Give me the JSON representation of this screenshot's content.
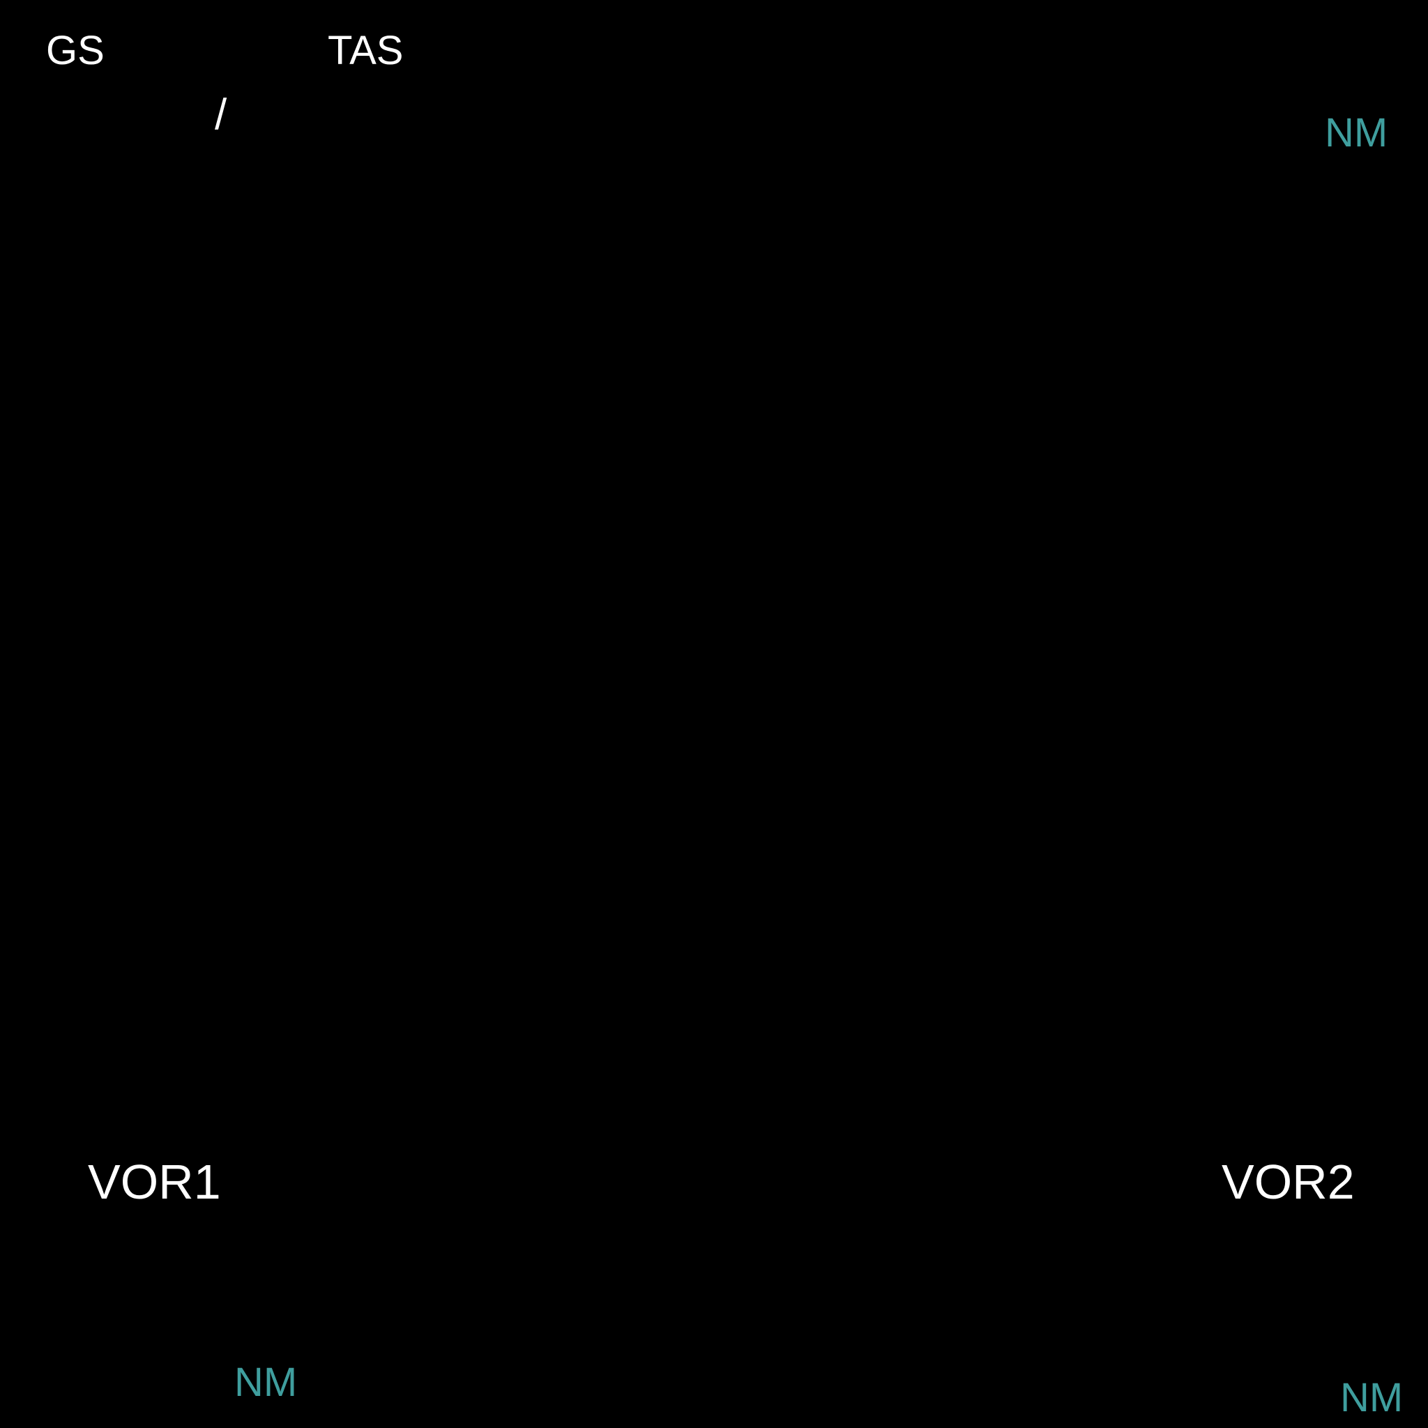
{
  "header": {
    "gs_label": "GS",
    "tas_label": "TAS",
    "separator": "/",
    "range_unit": "NM"
  },
  "vor1": {
    "label": "VOR1",
    "dist_unit": "NM"
  },
  "vor2": {
    "label": "VOR2",
    "dist_unit": "NM"
  },
  "colors": {
    "background": "#000000",
    "text": "#ffffff",
    "unit": "#3f9e9e"
  }
}
